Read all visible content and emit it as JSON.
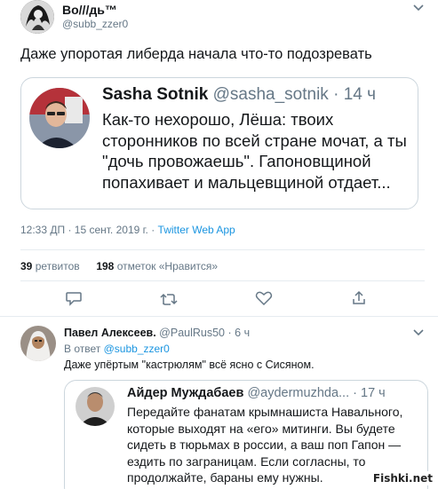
{
  "main_tweet": {
    "author_name": "Во///дь™",
    "author_handle": "@subb_zzer0",
    "text": "Даже упоротая либерда начала что-то подозревать",
    "quoted": {
      "name": "Sasha Sotnik",
      "handle": "@sasha_sotnik",
      "time": "14 ч",
      "separator": "·",
      "text": "Как-то нехорошо, Лёша: твоих сторонников по всей стране мочат, а ты \"дочь провожаешь\". Гапоновщиной попахивает и мальцевщиной отдает..."
    },
    "timestamp": "12:33 ДП · 15 сент. 2019 г. ·",
    "source": "Twitter Web App",
    "retweets_count": "39",
    "retweets_label": "ретвитов",
    "likes_count": "198",
    "likes_label": "отметок «Нравится»"
  },
  "reply": {
    "author_name": "Павел Алексеев.",
    "author_handle": "@PaulRus50",
    "separator": "·",
    "time": "6 ч",
    "reply_to_prefix": "В ответ",
    "reply_to_handle": "@subb_zzer0",
    "text": "Даже упёртым \"кастрюлям\" всё ясно с Сисяном.",
    "quoted": {
      "name": "Айдер Муждабаев",
      "handle": "@aydermuzhda...",
      "separator": "·",
      "time": "17 ч",
      "text": "Передайте фанатам крымнашиста Навального, которые выходят на «его» митинги. Вы будете сидеть в тюрьмах в россии, а ваш поп Гапон — ездить по заграницам. Если согласны, то продолжайте, бараны ему нужны."
    }
  },
  "watermark": "Fishki.net",
  "colors": {
    "link": "#1b95e0",
    "muted": "#657786",
    "border": "#ccd6dd",
    "text": "#14171a"
  }
}
